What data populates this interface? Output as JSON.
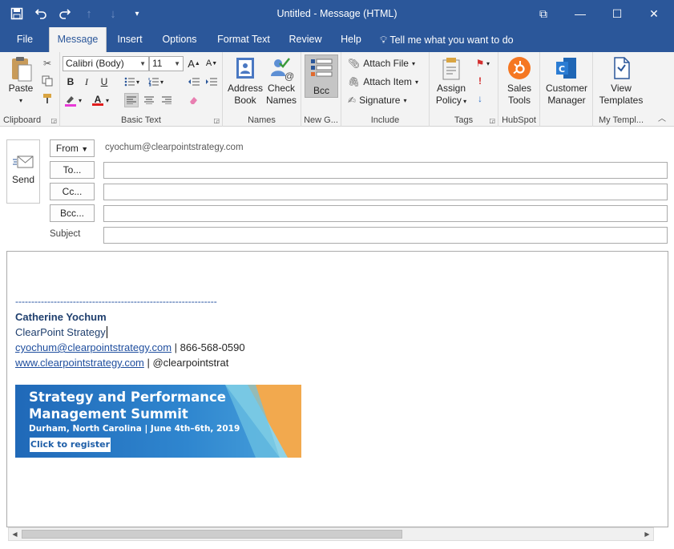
{
  "window": {
    "title": "Untitled  -  Message (HTML)",
    "controls": {
      "restore": "⧉",
      "minimize": "—",
      "maximize": "☐",
      "close": "✕"
    }
  },
  "qat": {
    "save_icon": "floppy-icon",
    "undo_icon": "undo-icon",
    "redo_icon": "redo-icon"
  },
  "tabs": [
    {
      "label": "File"
    },
    {
      "label": "Message",
      "active": true
    },
    {
      "label": "Insert"
    },
    {
      "label": "Options"
    },
    {
      "label": "Format Text"
    },
    {
      "label": "Review"
    },
    {
      "label": "Help"
    }
  ],
  "tell_me": "Tell me what you want to do",
  "ribbon": {
    "clipboard": {
      "paste": "Paste",
      "label": "Clipboard"
    },
    "basic_text": {
      "font": "Calibri (Body)",
      "size": "11",
      "label": "Basic Text"
    },
    "names": {
      "address_book_1": "Address",
      "address_book_2": "Book",
      "check_names_1": "Check",
      "check_names_2": "Names",
      "label": "Names"
    },
    "new_group": {
      "bcc": "Bcc",
      "label": "New G..."
    },
    "include": {
      "attach_file": "Attach File",
      "attach_item": "Attach Item",
      "signature": "Signature",
      "label": "Include"
    },
    "tags": {
      "assign_1": "Assign",
      "assign_2": "Policy",
      "label": "Tags"
    },
    "hubspot": {
      "sales_1": "Sales",
      "sales_2": "Tools",
      "label": "HubSpot"
    },
    "customer": {
      "cm_1": "Customer",
      "cm_2": "Manager"
    },
    "templates": {
      "vt_1": "View",
      "vt_2": "Templates",
      "label": "My Templ..."
    }
  },
  "compose": {
    "send": "Send",
    "from_label": "From",
    "from_value": "cyochum@clearpointstrategy.com",
    "to_label": "To...",
    "cc_label": "Cc...",
    "bcc_label": "Bcc...",
    "subject_label": "Subject"
  },
  "signature": {
    "divider": "---------------------------------------------------------------",
    "name": "Catherine Yochum",
    "company": "ClearPoint Strategy",
    "email": "cyochum@clearpointstrategy.com",
    "phone": " | 866-568-0590",
    "website": "www.clearpointstrategy.com",
    "handle": " | @clearpointstrat"
  },
  "banner": {
    "line1": "Strategy and Performance",
    "line2": "Management Summit",
    "line3": "Durham, North Carolina | June 4th–6th, 2019",
    "cta": "Click to register"
  }
}
